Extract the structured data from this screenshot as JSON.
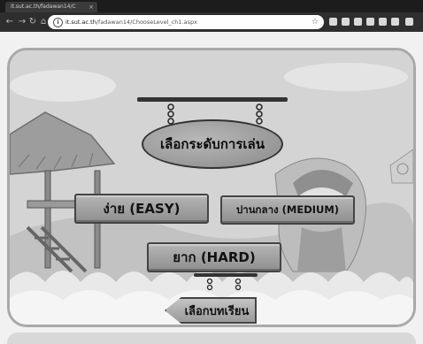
{
  "browser": {
    "tab_title": "it.sut.ac.th/fadawan14/C",
    "tab_close": "×",
    "url_host": "it.sut.ac.th",
    "url_path": "/fadawan14/ChooseLevel_ch1.aspx",
    "back_glyph": "←",
    "forward_glyph": "→",
    "reload_glyph": "↻",
    "home_glyph": "⌂",
    "info_glyph": "i",
    "star_glyph": "☆"
  },
  "game": {
    "title": "เลือกระดับการเล่น",
    "easy_label": "ง่าย (EASY)",
    "medium_label": "ปานกลาง (MEDIUM)",
    "hard_label": "ยาก (HARD)",
    "back_label": "เลือกบทเรียน"
  },
  "colors": {
    "frame": "#a9a9a9",
    "plank": "#9f9f9f",
    "chrome": "#2e2e2e"
  }
}
